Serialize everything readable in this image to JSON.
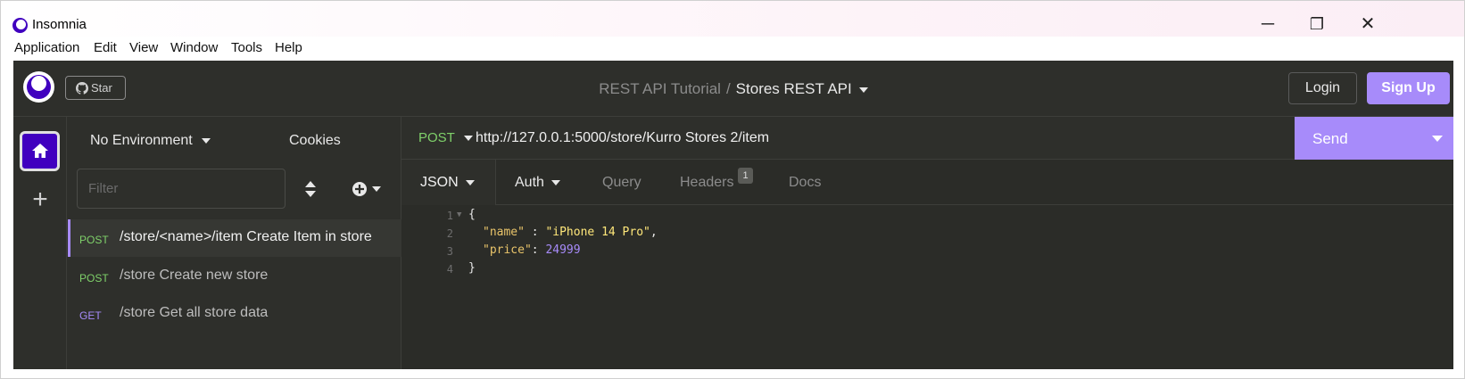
{
  "window": {
    "title": "Insomnia",
    "controls": {
      "minimize": "─",
      "restore": "❐",
      "close": "✕"
    }
  },
  "menubar": [
    "Application",
    "Edit",
    "View",
    "Window",
    "Tools",
    "Help"
  ],
  "topbar": {
    "star_label": "Star",
    "project": "REST API Tutorial",
    "separator": "/",
    "collection": "Stores REST API",
    "login_label": "Login",
    "signup_label": "Sign Up"
  },
  "rail": {
    "home_icon": "home-icon",
    "add_icon": "plus-icon"
  },
  "sidebar": {
    "environment": "No Environment",
    "cookies_label": "Cookies",
    "filter_placeholder": "Filter",
    "requests": [
      {
        "method": "POST",
        "name": "/store/<name>/item Create Item in store",
        "active": true
      },
      {
        "method": "POST",
        "name": "/store Create new store",
        "active": false
      },
      {
        "method": "GET",
        "name": "/store Get all store data",
        "active": false
      }
    ]
  },
  "request": {
    "method": "POST",
    "url": "http://127.0.0.1:5000/store/Kurro Stores 2/item",
    "send_label": "Send",
    "tabs": [
      {
        "label": "JSON",
        "has_caret": true,
        "active": true
      },
      {
        "label": "Auth",
        "has_caret": true,
        "active": false
      },
      {
        "label": "Query",
        "active": false
      },
      {
        "label": "Headers",
        "badge": "1",
        "active": false
      },
      {
        "label": "Docs",
        "active": false
      }
    ],
    "body_lines": [
      {
        "num": "1",
        "text": "{"
      },
      {
        "num": "2",
        "key": "\"name\"",
        "sep": " : ",
        "value": "\"iPhone 14 Pro\"",
        "trail": ","
      },
      {
        "num": "3",
        "key": "\"price\"",
        "sep": ": ",
        "number": "24999"
      },
      {
        "num": "4",
        "text": "}"
      }
    ]
  },
  "colors": {
    "accent": "#a78bfa",
    "brand": "#4000bf",
    "post": "#7fd16a",
    "get": "#a78bfa",
    "bg": "#2e2f2b"
  }
}
